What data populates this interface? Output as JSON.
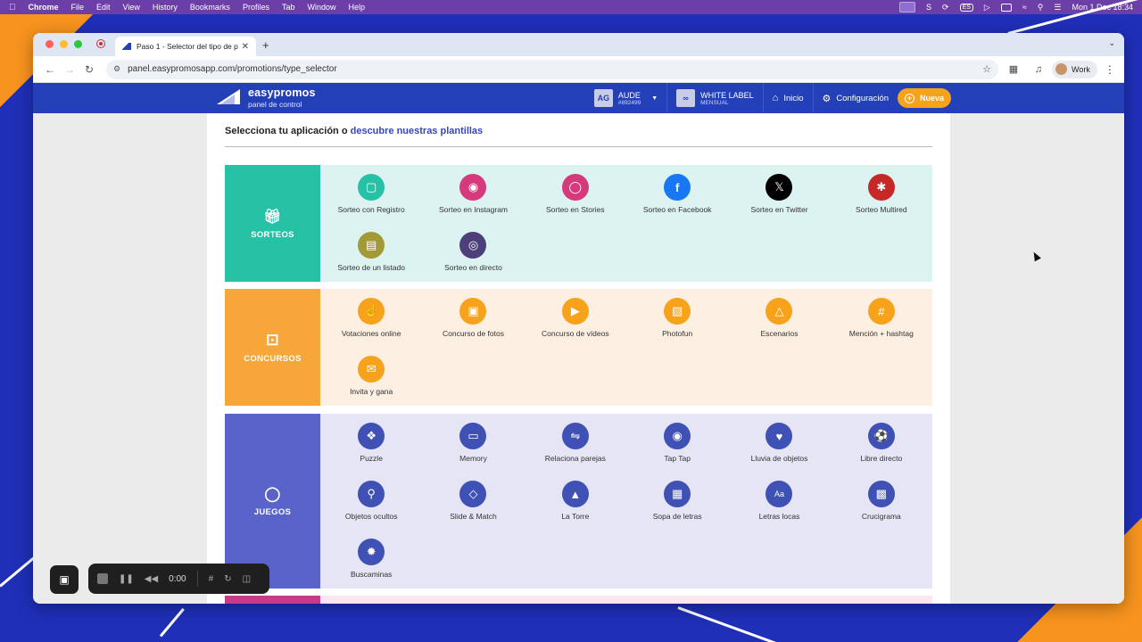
{
  "menubar": {
    "app": "Chrome",
    "items": [
      "File",
      "Edit",
      "View",
      "History",
      "Bookmarks",
      "Profiles",
      "Tab",
      "Window",
      "Help"
    ],
    "lang_badge": "ES",
    "datetime": "Mon 1 Dec  18:34"
  },
  "browser": {
    "tab_title": "Paso 1 - Selector del tipo de p",
    "url": "panel.easypromosapp.com/promotions/type_selector",
    "profile_label": "Work"
  },
  "header": {
    "brand": "easypromos",
    "brand_sub": "panel de control",
    "account_initials": "AG",
    "account_name": "AUDE",
    "account_id": "#892499",
    "plan_icon": "∞",
    "plan_name": "WHITE LABEL",
    "plan_period": "MENSUAL",
    "home_label": "Inicio",
    "settings_label": "Configuración",
    "new_label": "Nueva",
    "accent_color": "#2340b8",
    "button_color": "#f7a21b"
  },
  "page": {
    "title_prefix": "Selecciona tu aplicación o ",
    "title_link": "descubre nuestras plantillas"
  },
  "sections": {
    "sorteos": {
      "label": "SORTEOS",
      "items": [
        {
          "label": "Sorteo con Registro",
          "icon": "gift-icon"
        },
        {
          "label": "Sorteo en Instagram",
          "icon": "instagram-icon"
        },
        {
          "label": "Sorteo en Stories",
          "icon": "stories-icon"
        },
        {
          "label": "Sorteo en Facebook",
          "icon": "facebook-icon"
        },
        {
          "label": "Sorteo en Twitter",
          "icon": "x-icon"
        },
        {
          "label": "Sorteo Multired",
          "icon": "network-icon"
        },
        {
          "label": "Sorteo de un listado",
          "icon": "list-icon"
        },
        {
          "label": "Sorteo en directo",
          "icon": "broadcast-icon"
        }
      ]
    },
    "concursos": {
      "label": "CONCURSOS",
      "items": [
        {
          "label": "Votaciones online",
          "icon": "thumbs-up-icon"
        },
        {
          "label": "Concurso de fotos",
          "icon": "camera-icon"
        },
        {
          "label": "Concurso de vídeos",
          "icon": "video-icon"
        },
        {
          "label": "Photofun",
          "icon": "sticker-icon"
        },
        {
          "label": "Escenarios",
          "icon": "scenario-icon"
        },
        {
          "label": "Mención + hashtag",
          "icon": "hashtag-icon"
        },
        {
          "label": "Invita y gana",
          "icon": "invite-icon"
        }
      ]
    },
    "juegos": {
      "label": "JUEGOS",
      "items": [
        {
          "label": "Puzzle",
          "icon": "puzzle-icon"
        },
        {
          "label": "Memory",
          "icon": "cards-icon"
        },
        {
          "label": "Relaciona parejas",
          "icon": "match-icon"
        },
        {
          "label": "Tap Tap",
          "icon": "tap-icon"
        },
        {
          "label": "Lluvia de objetos",
          "icon": "catch-icon"
        },
        {
          "label": "Libre directo",
          "icon": "soccer-icon"
        },
        {
          "label": "Objetos ocultos",
          "icon": "magnifier-icon"
        },
        {
          "label": "Slide & Match",
          "icon": "diamond-icon"
        },
        {
          "label": "La Torre",
          "icon": "tower-icon"
        },
        {
          "label": "Sopa de letras",
          "icon": "wordsearch-icon"
        },
        {
          "label": "Letras locas",
          "icon": "letters-icon"
        },
        {
          "label": "Crucigrama",
          "icon": "crossword-icon"
        },
        {
          "label": "Buscaminas",
          "icon": "mine-icon"
        }
      ]
    }
  },
  "recorder": {
    "time": "0:00"
  }
}
